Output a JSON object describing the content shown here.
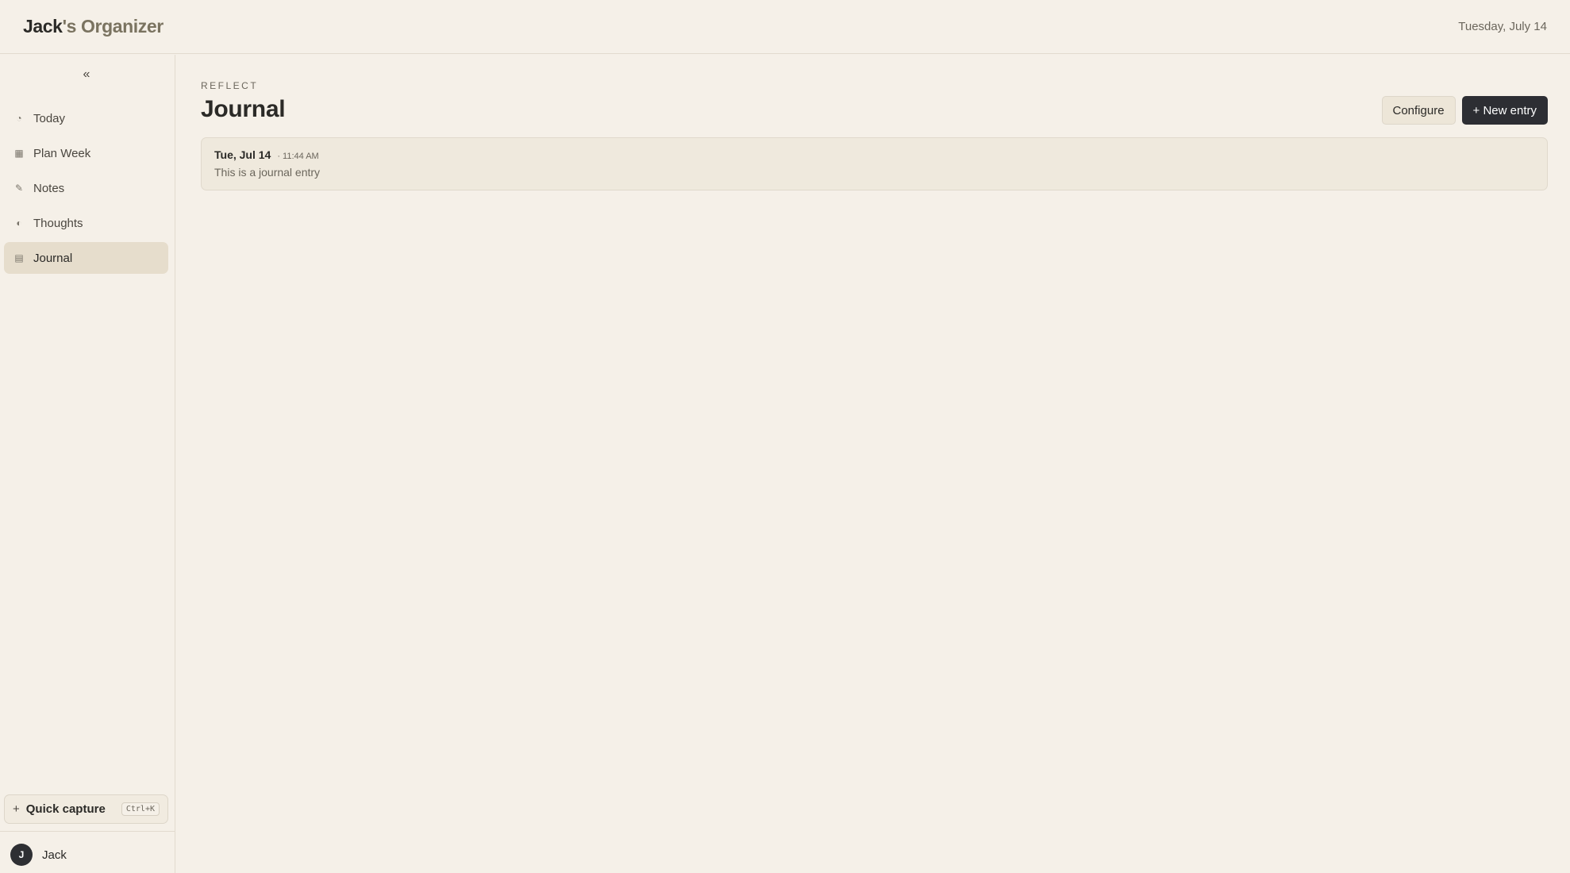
{
  "header": {
    "brand_first": "Jack",
    "brand_rest": "'s Organizer",
    "date": "Tuesday, July 14"
  },
  "sidebar": {
    "collapse_glyph": "«",
    "items": [
      {
        "label": "Today",
        "icon": "clock-icon",
        "glyph": "◔",
        "active": false
      },
      {
        "label": "Plan Week",
        "icon": "grid-icon",
        "glyph": "▦",
        "active": false
      },
      {
        "label": "Notes",
        "icon": "pencil-icon",
        "glyph": "✎",
        "active": false
      },
      {
        "label": "Thoughts",
        "icon": "half-circle-icon",
        "glyph": "◐",
        "active": false
      },
      {
        "label": "Journal",
        "icon": "list-icon",
        "glyph": "▤",
        "active": true
      }
    ],
    "quick_capture": {
      "plus": "+",
      "label": "Quick capture",
      "shortcut": "Ctrl+K"
    },
    "user": {
      "initial": "J",
      "name": "Jack"
    }
  },
  "main": {
    "eyebrow": "REFLECT",
    "title": "Journal",
    "configure_label": "Configure",
    "new_entry_label": "+ New entry",
    "entries": [
      {
        "date": "Tue, Jul 14",
        "time": "· 11:44 AM",
        "text": "This is a journal entry"
      }
    ]
  },
  "colors": {
    "background": "#f5f0e8",
    "active_nav": "#e6ddcc",
    "primary_button": "#2d2e33",
    "brand_accent": "#7a7360"
  }
}
